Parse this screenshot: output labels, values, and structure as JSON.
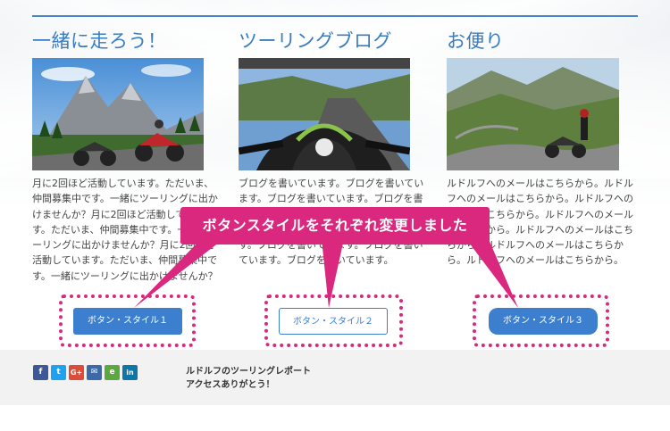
{
  "columns": [
    {
      "title": "一緒に走ろう！",
      "text": "月に2回ほど活動しています。ただいま、仲間募集中です。一緒にツーリングに出かけませんか？月に2回ほど活動しています。ただいま、仲間募集中です。一緒にツーリングに出かけませんか？月に2回ほど活動しています。ただいま、仲間募集中です。一緒にツーリングに出かけませんか？",
      "button_label": "ボタン・スタイル１"
    },
    {
      "title": "ツーリングブログ",
      "text": "ブログを書いています。ブログを書いています。ブログを書いています。ブログを書いています。ブログを書いています。ブログを書いています。ブログを書いています。ブログを書いています。ブログを書いています。ブログを書いています。",
      "button_label": "ボタン・スタイル２"
    },
    {
      "title": "お便り",
      "text": "ルドルフへのメールはこちらから。ルドルフへのメールはこちらから。ルドルフへのメールはこちらから。ルドルフへのメールはこちらから。ルドルフへのメールはこちらから。ルドルフへのメールはこちらから。ルドルフへのメールはこちらから。",
      "button_label": "ボタン・スタイル３"
    }
  ],
  "callout": {
    "text": "ボタンスタイルをそれぞれ変更しました"
  },
  "footer": {
    "line1": "ルドルフのツーリングレポート",
    "line2": "アクセスありがとう！",
    "social": [
      {
        "icon": "facebook-icon",
        "glyph": "f",
        "color": "#3b5998"
      },
      {
        "icon": "twitter-icon",
        "glyph": "t",
        "color": "#1da1f2"
      },
      {
        "icon": "google-plus-icon",
        "glyph": "G+",
        "color": "#dd4b39"
      },
      {
        "icon": "mail-icon",
        "glyph": "✉",
        "color": "#3c6aa8"
      },
      {
        "icon": "evernote-icon",
        "glyph": "e",
        "color": "#5aa83f"
      },
      {
        "icon": "linkedin-icon",
        "glyph": "in",
        "color": "#0e76a8"
      }
    ]
  },
  "colors": {
    "accent": "#3a7cc1",
    "callout": "#d9287e",
    "footer_bg": "#f2f2f2"
  }
}
